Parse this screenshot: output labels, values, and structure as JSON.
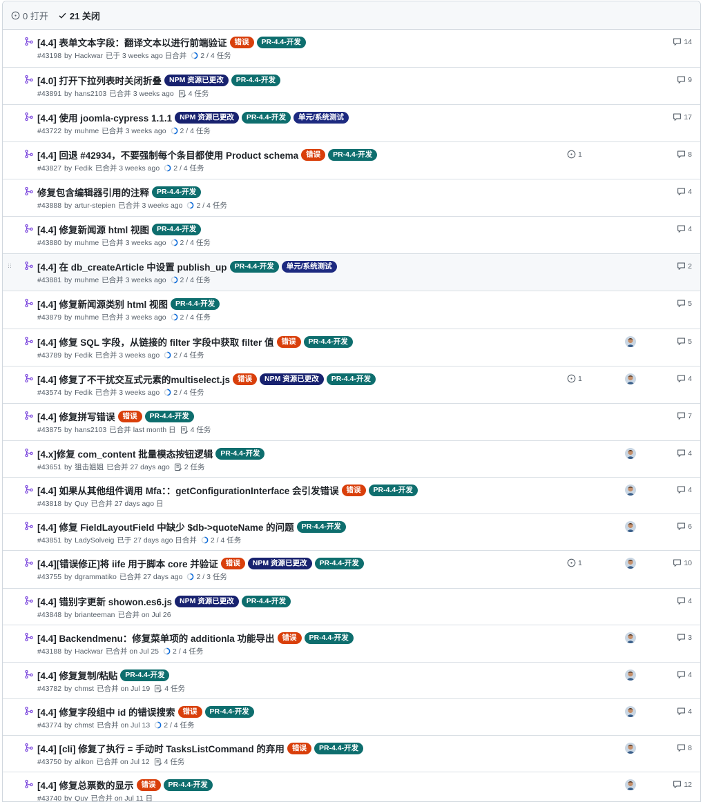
{
  "header": {
    "open": "0 打开",
    "closed": "21 关闭"
  },
  "labels": {
    "bug": "错误",
    "pr": "PR-4.4-开发",
    "npm": "NPM 资源已更改",
    "unit": "单元/系统测试"
  },
  "colors": {
    "bug": "#d93f0b",
    "pr": "#0e6e6e",
    "npm": "#18226f",
    "unit": "#1d2a80",
    "merged_icon": "#8250df"
  },
  "pulls": [
    {
      "title": "[4.4] 表单文本字段：翻译文本以进行前端验证",
      "labels": [
        "bug",
        "pr"
      ],
      "number": "#43198",
      "author": "Hackwar",
      "status": "已于 3 weeks ago 日合并",
      "task_icon": "progress",
      "tasks": "2 / 4 任务",
      "issues": "",
      "avatar": false,
      "comments": "14"
    },
    {
      "title": "[4.0] 打开下拉列表时关闭折叠",
      "labels": [
        "npm",
        "pr"
      ],
      "number": "#43891",
      "author": "hans2103",
      "status": "已合并 3 weeks ago",
      "task_icon": "list",
      "tasks": "4 任务",
      "issues": "",
      "avatar": false,
      "comments": "9"
    },
    {
      "title": "[4.4] 使用 joomla-cypress 1.1.1",
      "labels": [
        "npm",
        "pr",
        "unit"
      ],
      "number": "#43722",
      "author": "muhme",
      "status": "已合并 3 weeks ago",
      "task_icon": "progress",
      "tasks": "2 / 4 任务",
      "issues": "",
      "avatar": false,
      "comments": "17"
    },
    {
      "title": "[4.4] 回退 #42934，不要强制每个条目都使用 Product schema",
      "labels": [
        "bug",
        "pr"
      ],
      "number": "#43827",
      "author": "Fedik",
      "status": "已合并 3 weeks ago",
      "task_icon": "progress",
      "tasks": "2 / 4 任务",
      "issues": "1",
      "avatar": false,
      "comments": "8"
    },
    {
      "title": "修复包含编辑器引用的注释",
      "labels": [
        "pr"
      ],
      "number": "#43888",
      "author": "artur-stepien",
      "status": "已合并 3 weeks ago",
      "task_icon": "progress",
      "tasks": "2 / 4 任务",
      "issues": "",
      "avatar": false,
      "comments": "4"
    },
    {
      "title": "[4.4] 修复新闻源 html 视图",
      "labels": [
        "pr"
      ],
      "number": "#43880",
      "author": "muhme",
      "status": "已合并 3 weeks ago",
      "task_icon": "progress",
      "tasks": "2 / 4 任务",
      "issues": "",
      "avatar": false,
      "comments": "4"
    },
    {
      "title": "[4.4] 在 db_createArticle 中设置 publish_up",
      "labels": [
        "pr",
        "unit"
      ],
      "number": "#43881",
      "author": "muhme",
      "status": "已合并 3 weeks ago",
      "task_icon": "progress",
      "tasks": "2 / 4 任务",
      "issues": "",
      "avatar": false,
      "comments": "2"
    },
    {
      "title": "[4.4] 修复新闻源类别 html 视图",
      "labels": [
        "pr"
      ],
      "number": "#43879",
      "author": "muhme",
      "status": "已合并 3 weeks ago",
      "task_icon": "progress",
      "tasks": "2 / 4 任务",
      "issues": "",
      "avatar": false,
      "comments": "5"
    },
    {
      "title": "[4.4] 修复 SQL 字段，从链接的 filter 字段中获取 filter 值",
      "labels": [
        "bug",
        "pr"
      ],
      "number": "#43789",
      "author": "Fedik",
      "status": "已合并 3 weeks ago",
      "task_icon": "progress",
      "tasks": "2 / 4 任务",
      "issues": "",
      "avatar": true,
      "comments": "5"
    },
    {
      "title": "[4.4] 修复了不干扰交互式元素的multiselect.js",
      "labels": [
        "bug",
        "npm",
        "pr"
      ],
      "number": "#43574",
      "author": "Fedik",
      "status": "已合并 3 weeks ago",
      "task_icon": "progress",
      "tasks": "2 / 4 任务",
      "issues": "1",
      "avatar": true,
      "comments": "4"
    },
    {
      "title": "[4.4] 修复拼写错误",
      "labels": [
        "bug",
        "pr"
      ],
      "number": "#43875",
      "author": "hans2103",
      "status": "已合并 last month 日",
      "task_icon": "list",
      "tasks": "4 任务",
      "issues": "",
      "avatar": false,
      "comments": "7"
    },
    {
      "title": "[4.x]修复 com_content 批量模态按钮逻辑",
      "labels": [
        "pr"
      ],
      "number": "#43651",
      "author": "狙击姐姐",
      "status": "已合并 27 days ago",
      "task_icon": "list",
      "tasks": "2 任务",
      "issues": "",
      "avatar": true,
      "comments": "4"
    },
    {
      "title": "[4.4] 如果从其他组件调用 Mfa：：getConfigurationInterface 会引发错误",
      "labels": [
        "bug",
        "pr"
      ],
      "number": "#43818",
      "author": "Quy",
      "status": "已合并 27 days ago 日",
      "task_icon": "",
      "tasks": "",
      "issues": "",
      "avatar": true,
      "comments": "4"
    },
    {
      "title": "[4.4] 修复 FieldLayoutField 中缺少 $db->quoteName 的问题",
      "labels": [
        "pr"
      ],
      "number": "#43851",
      "author": "LadySolveig",
      "status": "已于 27 days ago 日合并",
      "task_icon": "progress",
      "tasks": "2 / 4 任务",
      "issues": "",
      "avatar": true,
      "comments": "6"
    },
    {
      "title": "[4.4][错误修正]将 iife 用于脚本 core 并验证",
      "labels": [
        "bug",
        "npm",
        "pr"
      ],
      "number": "#43755",
      "author": "dgrammatiko",
      "status": "已合并 27 days ago",
      "task_icon": "progress",
      "tasks": "2 / 3 任务",
      "issues": "1",
      "avatar": true,
      "comments": "10"
    },
    {
      "title": "[4.4] 错别字更新 showon.es6.js",
      "labels": [
        "npm",
        "pr"
      ],
      "number": "#43848",
      "author": "brianteeman",
      "status": "已合并 on Jul 26",
      "task_icon": "",
      "tasks": "",
      "issues": "",
      "avatar": false,
      "comments": "4"
    },
    {
      "title": "[4.4] Backendmenu：修复菜单项的 additionla 功能导出",
      "labels": [
        "bug",
        "pr"
      ],
      "number": "#43188",
      "author": "Hackwar",
      "status": "已合并 on Jul 25",
      "task_icon": "progress",
      "tasks": "2 / 4 任务",
      "issues": "",
      "avatar": true,
      "comments": "3"
    },
    {
      "title": "[4.4] 修复复制/粘贴",
      "labels": [
        "pr"
      ],
      "number": "#43782",
      "author": "chmst",
      "status": "已合并 on Jul 19",
      "task_icon": "list",
      "tasks": "4 任务",
      "issues": "",
      "avatar": true,
      "comments": "4"
    },
    {
      "title": "[4.4] 修复字段组中 id 的错误搜索",
      "labels": [
        "bug",
        "pr"
      ],
      "number": "#43774",
      "author": "chmst",
      "status": "已合并 on Jul 13",
      "task_icon": "progress",
      "tasks": "2 / 4 任务",
      "issues": "",
      "avatar": true,
      "comments": "4"
    },
    {
      "title": "[4.4] [cli] 修复了执行 = 手动时 TasksListCommand 的弃用",
      "labels": [
        "bug",
        "pr"
      ],
      "number": "#43750",
      "author": "alikon",
      "status": "已合并 on Jul 12",
      "task_icon": "list",
      "tasks": "4 任务",
      "issues": "",
      "avatar": true,
      "comments": "8"
    },
    {
      "title": "[4.4] 修复总票数的显示",
      "labels": [
        "bug",
        "pr"
      ],
      "number": "#43740",
      "author": "Quy",
      "status": "已合并 on Jul 11 日",
      "task_icon": "",
      "tasks": "",
      "issues": "",
      "avatar": true,
      "comments": "12"
    }
  ]
}
